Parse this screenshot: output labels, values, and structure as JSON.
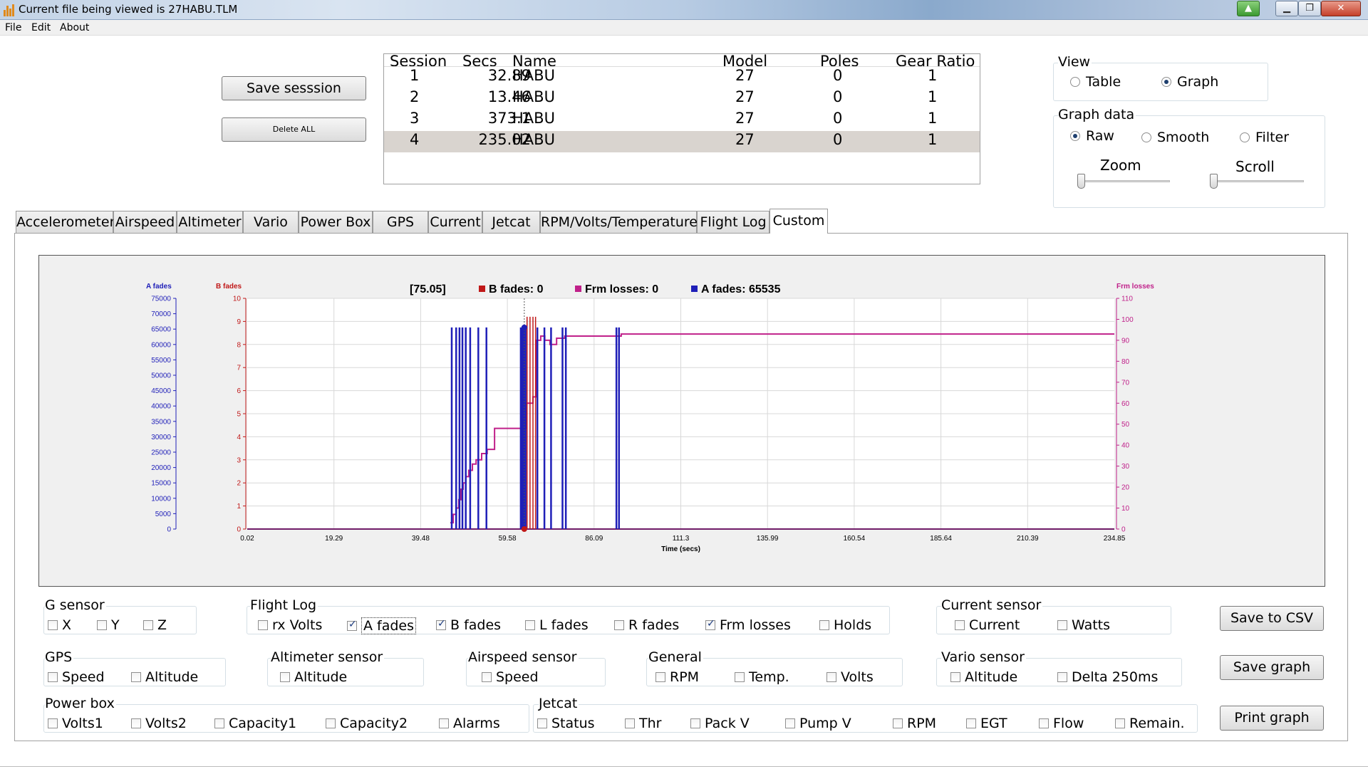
{
  "window": {
    "title": "Current file being viewed is 27HABU.TLM"
  },
  "menu": {
    "file": "File",
    "edit": "Edit",
    "about": "About"
  },
  "buttons": {
    "save_session": "Save sesssion",
    "delete_all": "Delete ALL",
    "save_csv": "Save to CSV",
    "save_graph": "Save graph",
    "print_graph": "Print graph"
  },
  "sessions": {
    "headers": [
      "Session",
      "Secs",
      "Name",
      "Model",
      "Poles",
      "Gear Ratio"
    ],
    "rows": [
      {
        "session": "1",
        "secs": "32.89",
        "name": "HABU",
        "model": "27",
        "poles": "0",
        "gear": "1"
      },
      {
        "session": "2",
        "secs": "13.46",
        "name": "HABU",
        "model": "27",
        "poles": "0",
        "gear": "1"
      },
      {
        "session": "3",
        "secs": "373.1",
        "name": "HABU",
        "model": "27",
        "poles": "0",
        "gear": "1"
      },
      {
        "session": "4",
        "secs": "235.02",
        "name": "HABU",
        "model": "27",
        "poles": "0",
        "gear": "1"
      }
    ],
    "selected_row": 4
  },
  "view": {
    "label": "View",
    "table": "Table",
    "graph": "Graph",
    "selected": "Graph"
  },
  "graph_data": {
    "label": "Graph data",
    "raw": "Raw",
    "smooth": "Smooth",
    "filter": "Filter",
    "selected": "Raw",
    "zoom": "Zoom",
    "scroll": "Scroll"
  },
  "tabs": [
    "Accelerometer",
    "Airspeed",
    "Altimeter",
    "Vario",
    "Power Box",
    "GPS",
    "Current",
    "Jetcat",
    "RPM/Volts/Temperature",
    "Flight Log",
    "Custom"
  ],
  "active_tab": "Custom",
  "colors": {
    "a_fades": "#1f1fb8",
    "b_fades": "#c01818",
    "frm_losses": "#c0208a",
    "grid": "#d8d8d8"
  },
  "chart_data": {
    "type": "line",
    "xlabel": "Time (secs)",
    "x_ticks": [
      "0.02",
      "19.29",
      "39.48",
      "59.58",
      "86.09",
      "111.3",
      "135.99",
      "160.54",
      "185.64",
      "210.39",
      "234.85"
    ],
    "xlim": [
      0.02,
      234.85
    ],
    "y_axes": [
      {
        "name": "A fades",
        "ticks": [
          "0",
          "5000",
          "10000",
          "15000",
          "20000",
          "25000",
          "30000",
          "35000",
          "40000",
          "45000",
          "50000",
          "55000",
          "60000",
          "65000",
          "70000",
          "75000"
        ],
        "range": [
          0,
          75000
        ]
      },
      {
        "name": "B fades",
        "ticks": [
          "0",
          "1",
          "2",
          "3",
          "4",
          "5",
          "6",
          "7",
          "8",
          "9",
          "10"
        ],
        "range": [
          0,
          10
        ]
      },
      {
        "name": "Frm losses",
        "ticks": [
          "0",
          "10",
          "20",
          "30",
          "40",
          "50",
          "60",
          "70",
          "80",
          "90",
          "100",
          "110"
        ],
        "range": [
          0,
          110
        ]
      }
    ],
    "cursor": {
      "x": 75.05,
      "label": "[75.05]"
    },
    "legend": [
      {
        "name": "B fades",
        "value": "B fades: 0"
      },
      {
        "name": "Frm losses",
        "value": "Frm losses: 0"
      },
      {
        "name": "A fades",
        "value": "A fades: 65535"
      }
    ],
    "series": [
      {
        "name": "A fades",
        "axis": 0,
        "spikes_x": [
          55.4,
          56.6,
          57.5,
          58.3,
          59.2,
          60.4,
          62.6,
          64.8,
          74.1,
          74.4,
          74.7,
          75.1,
          75.4,
          78.6,
          80.5,
          82.3,
          85.4,
          86.3,
          100.0,
          100.7
        ],
        "spike_value": 65535
      },
      {
        "name": "Frm losses",
        "axis": 2,
        "points": [
          [
            55.0,
            3
          ],
          [
            55.8,
            7
          ],
          [
            56.6,
            10
          ],
          [
            57.3,
            14
          ],
          [
            57.9,
            19
          ],
          [
            58.5,
            22
          ],
          [
            59.2,
            25
          ],
          [
            60.0,
            28
          ],
          [
            61.0,
            31
          ],
          [
            62.0,
            33
          ],
          [
            63.5,
            36
          ],
          [
            65.0,
            38
          ],
          [
            67.0,
            48
          ],
          [
            75.0,
            48
          ],
          [
            75.6,
            60
          ],
          [
            77.4,
            63
          ],
          [
            78.2,
            90
          ],
          [
            79.5,
            92
          ],
          [
            80.6,
            90
          ],
          [
            82.0,
            88
          ],
          [
            83.8,
            91
          ],
          [
            86.0,
            92
          ],
          [
            100.0,
            92
          ],
          [
            101.3,
            93
          ],
          [
            234.85,
            93
          ]
        ]
      },
      {
        "name": "B fades",
        "axis": 1,
        "points": [
          [
            0.02,
            0
          ],
          [
            234.85,
            0
          ]
        ],
        "spikes_x": [
          75.8,
          76.6,
          77.4,
          78.1
        ]
      }
    ]
  },
  "sensors": {
    "g": {
      "label": "G sensor",
      "items": [
        "X",
        "Y",
        "Z"
      ]
    },
    "flight_log": {
      "label": "Flight Log",
      "items": [
        "rx Volts",
        "A fades",
        "B fades",
        "L fades",
        "R fades",
        "Frm losses",
        "Holds"
      ],
      "checked": [
        "A fades",
        "B fades",
        "Frm losses"
      ]
    },
    "current": {
      "label": "Current sensor",
      "items": [
        "Current",
        "Watts"
      ]
    },
    "gps": {
      "label": "GPS",
      "items": [
        "Speed",
        "Altitude"
      ]
    },
    "altimeter": {
      "label": "Altimeter sensor",
      "items": [
        "Altitude"
      ]
    },
    "airspeed": {
      "label": "Airspeed sensor",
      "items": [
        "Speed"
      ]
    },
    "general": {
      "label": "General",
      "items": [
        "RPM",
        "Temp.",
        "Volts"
      ]
    },
    "vario": {
      "label": "Vario sensor",
      "items": [
        "Altitude",
        "Delta 250ms"
      ]
    },
    "power_box": {
      "label": "Power box",
      "items": [
        "Volts1",
        "Volts2",
        "Capacity1",
        "Capacity2",
        "Alarms"
      ]
    },
    "jetcat": {
      "label": "Jetcat",
      "items": [
        "Status",
        "Thr",
        "Pack V",
        "Pump V",
        "RPM",
        "EGT",
        "Flow",
        "Remain."
      ]
    }
  }
}
